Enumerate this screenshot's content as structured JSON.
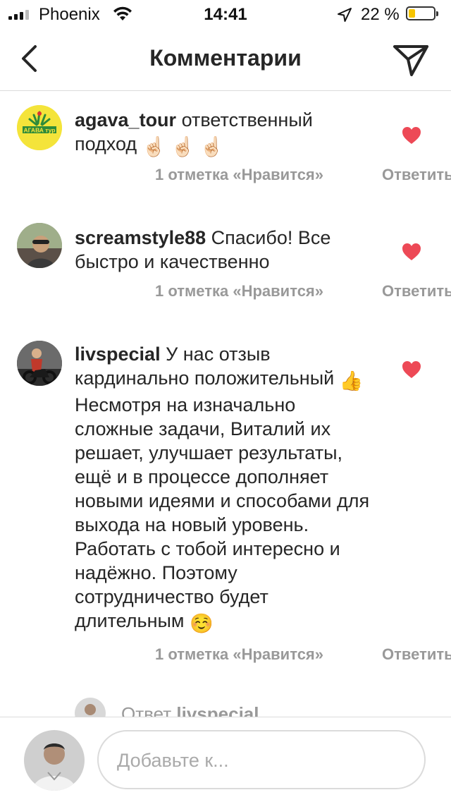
{
  "status_bar": {
    "carrier": "Phoenix",
    "time": "14:41",
    "battery": "22 %",
    "battery_level": 0.22
  },
  "header": {
    "title": "Комментарии",
    "back_icon": "chevron-left-icon",
    "send_icon": "paper-plane-icon"
  },
  "comments": [
    {
      "username": "agava_tour",
      "text": "ответственный подход",
      "emoji": "☝🏻 ☝🏻 ☝🏻",
      "likes": "1 отметка «Нравится»",
      "reply": "Ответить",
      "liked": true,
      "avatar_text": "АГАВА тур"
    },
    {
      "username": "screamstyle88",
      "text": "Спасибо! Все быстро и качественно",
      "likes": "1 отметка «Нравится»",
      "reply": "Ответить",
      "liked": true
    },
    {
      "username": "livspecial",
      "text_part1": "У нас отзыв кардинально положительный",
      "emoji_mid": "👍",
      "text_part2": "Несмотря на изначально сложные задачи, Виталий их решает, улучшает результаты, ещё и в процессе дополняет новыми идеями и способами для выхода на новый уровень. Работать с тобой интересно и надёжно. Поэтому сотрудничество будет длительным",
      "emoji_end": "☺️",
      "likes": "1 отметка «Нравится»",
      "reply": "Ответить",
      "liked": true
    }
  ],
  "sub_reply": {
    "prefix": "Ответ",
    "username": "livspecial"
  },
  "composer": {
    "placeholder": "Добавьте к..."
  },
  "colors": {
    "heart": "#ed4956",
    "meta_text": "#999999",
    "divider": "#dbdbdb",
    "battery_fill": "#f7c500"
  }
}
